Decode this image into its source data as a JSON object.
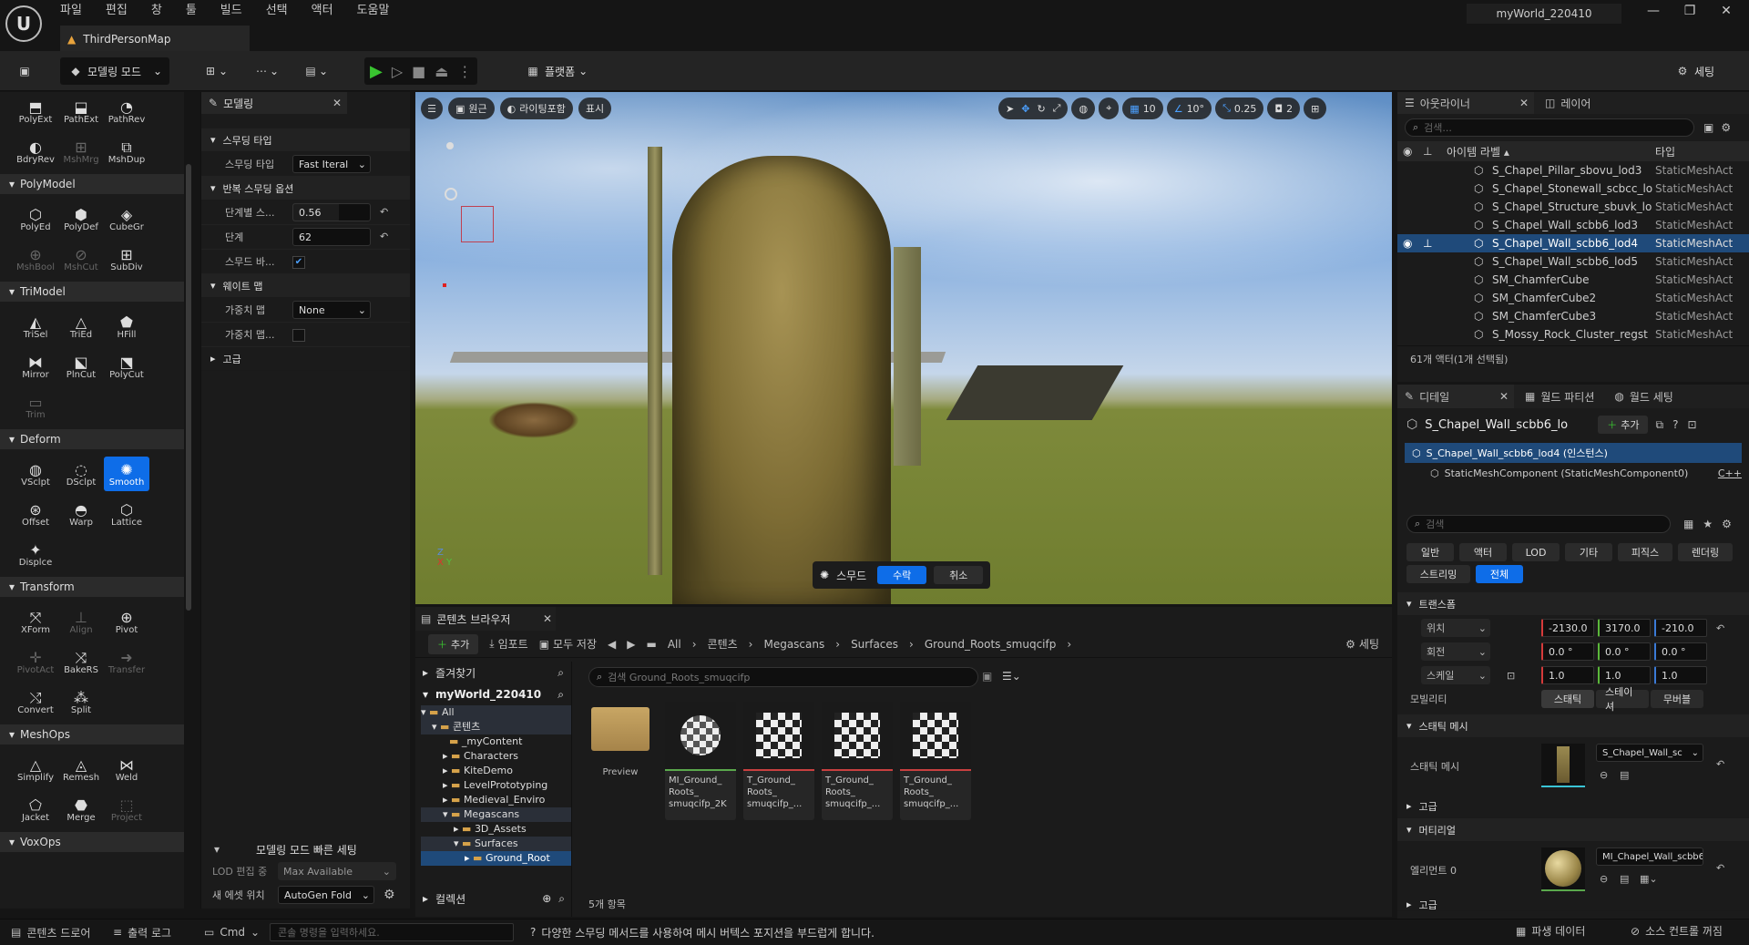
{
  "app": {
    "logo": "U",
    "project": "myWorld_220410",
    "map_tab": "ThirdPersonMap"
  },
  "menu": [
    "파일",
    "편집",
    "창",
    "툴",
    "빌드",
    "선택",
    "액터",
    "도움말"
  ],
  "toolbar": {
    "mode": "모델링 모드",
    "platform": "플랫폼",
    "settings": "세팅"
  },
  "left": {
    "top_row1": [
      "PolyExt",
      "PathExt",
      "PathRev"
    ],
    "top_row2": [
      "BdryRev",
      "MshMrg",
      "MshDup"
    ],
    "sections": [
      {
        "title": "PolyModel",
        "tools": [
          "PolyEd",
          "PolyDef",
          "CubeGr",
          "MshBool",
          "MshCut",
          "SubDiv"
        ]
      },
      {
        "title": "TriModel",
        "tools": [
          "TriSel",
          "TriEd",
          "HFill",
          "Mirror",
          "PlnCut",
          "PolyCut",
          "Trim"
        ]
      },
      {
        "title": "Deform",
        "tools": [
          "VSclpt",
          "DSclpt",
          "Smooth",
          "Offset",
          "Warp",
          "Lattice",
          "Displce"
        ]
      },
      {
        "title": "Transform",
        "tools": [
          "XForm",
          "Align",
          "Pivot",
          "PivotAct",
          "BakeRS",
          "Transfer",
          "Convert",
          "Split"
        ]
      },
      {
        "title": "MeshOps",
        "tools": [
          "Simplify",
          "Remesh",
          "Weld",
          "Jacket",
          "Merge",
          "Project"
        ]
      },
      {
        "title": "VoxOps",
        "tools": []
      }
    ]
  },
  "modeling": {
    "tab": "모델링",
    "smoothing_type_header": "스무딩 타입",
    "smoothing_type_label": "스무딩 타입",
    "smoothing_type_value": "Fast Iteral",
    "iter_header": "반복 스무딩 옵션",
    "step_label": "단계별 스...",
    "step_value": "0.56",
    "steps_label": "단계",
    "steps_value": "62",
    "smooth_boundary_label": "스무드 바...",
    "weight_header": "웨이트 맵",
    "weight_map_label": "가중치 맵",
    "weight_map_value": "None",
    "weight_map2_label": "가중치 맵...",
    "advanced": "고급",
    "quick_settings": "모델링 모드 빠른 세팅",
    "lod_label": "LOD 편집 중",
    "lod_value": "Max Available",
    "asset_label": "새 에셋 위치",
    "asset_value": "AutoGen Fold"
  },
  "viewport": {
    "perspective": "원근",
    "lighting": "라이팅포함",
    "show": "표시",
    "grid_value": "10",
    "angle_value": "10°",
    "scale_value": "0.25",
    "camera_value": "2",
    "smooth_label": "스무드",
    "accept": "수락",
    "cancel": "취소"
  },
  "content_browser": {
    "tab": "콘텐츠 브라우저",
    "add": "추가",
    "import": "임포트",
    "save_all": "모두 저장",
    "breadcrumb": [
      "All",
      "콘텐츠",
      "Megascans",
      "Surfaces",
      "Ground_Roots_smuqcifp"
    ],
    "settings": "세팅",
    "favorites": "즐겨찾기",
    "project": "myWorld_220410",
    "tree": [
      "All",
      "콘텐츠",
      "_myContent",
      "Characters",
      "KiteDemo",
      "LevelPrototyping",
      "Medieval_Enviro",
      "Megascans",
      "3D_Assets",
      "Surfaces",
      "Ground_Root"
    ],
    "collections": "컬렉션",
    "search_placeholder": "검색 Ground_Roots_smuqcifp",
    "assets": [
      {
        "name": "Preview"
      },
      {
        "name": "MI_Ground_ Roots_ smuqcifp_2K"
      },
      {
        "name": "T_Ground_ Roots_ smuqcifp_..."
      },
      {
        "name": "T_Ground_ Roots_ smuqcifp_..."
      },
      {
        "name": "T_Ground_ Roots_ smuqcifp_..."
      }
    ],
    "count": "5개 항목"
  },
  "outliner": {
    "tab": "아웃라이너",
    "layers": "레이어",
    "search_placeholder": "검색...",
    "col_label": "아이템 라벨 ▴",
    "col_type": "타입",
    "rows": [
      {
        "name": "S_Chapel_Pillar_sbovu_lod3",
        "type": "StaticMeshAct"
      },
      {
        "name": "S_Chapel_Stonewall_scbcc_lo",
        "type": "StaticMeshAct"
      },
      {
        "name": "S_Chapel_Structure_sbuvk_lo",
        "type": "StaticMeshAct"
      },
      {
        "name": "S_Chapel_Wall_scbb6_lod3",
        "type": "StaticMeshAct"
      },
      {
        "name": "S_Chapel_Wall_scbb6_lod4",
        "type": "StaticMeshAct"
      },
      {
        "name": "S_Chapel_Wall_scbb6_lod5",
        "type": "StaticMeshAct"
      },
      {
        "name": "SM_ChamferCube",
        "type": "StaticMeshAct"
      },
      {
        "name": "SM_ChamferCube2",
        "type": "StaticMeshAct"
      },
      {
        "name": "SM_ChamferCube3",
        "type": "StaticMeshAct"
      },
      {
        "name": "S_Mossy_Rock_Cluster_regst",
        "type": "StaticMeshAct"
      }
    ],
    "count": "61개 액터(1개 선택됨)"
  },
  "details": {
    "tab": "디테일",
    "world_partition": "월드 파티션",
    "world_settings": "월드 세팅",
    "actor_name": "S_Chapel_Wall_scbb6_lo",
    "add": "추가",
    "instance": "S_Chapel_Wall_scbb6_lod4 (인스턴스)",
    "component": "StaticMeshComponent (StaticMeshComponent0)",
    "component_tag": "C++",
    "search_placeholder": "검색",
    "filters": [
      "일반",
      "액터",
      "LOD",
      "기타",
      "피직스",
      "렌더링",
      "스트리밍",
      "전체"
    ],
    "transform": "트랜스폼",
    "location": "위치",
    "loc": [
      "-2130.0",
      "3170.0",
      "-210.0"
    ],
    "rotation": "회전",
    "rot": [
      "0.0 °",
      "0.0 °",
      "0.0 °"
    ],
    "scale": "스케일",
    "scl": [
      "1.0",
      "1.0",
      "1.0"
    ],
    "mobility": "모빌리티",
    "mobility_opts": [
      "스태틱",
      "스테이셔",
      "무버블"
    ],
    "static_mesh_header": "스태틱 메시",
    "static_mesh_label": "스태틱 메시",
    "static_mesh_value": "S_Chapel_Wall_sc",
    "advanced": "고급",
    "materials": "머티리얼",
    "element0": "엘리먼트 0",
    "element0_value": "MI_Chapel_Wall_scbb6",
    "more": "고급"
  },
  "statusbar": {
    "content_drawer": "콘텐츠 드로어",
    "output_log": "출력 로그",
    "cmd": "Cmd",
    "console_placeholder": "콘솔 명령을 입력하세요.",
    "message": "다양한 스무딩 메서드를 사용하여 메시 버텍스 포지션을 부드럽게 합니다.",
    "derived": "파생 데이터",
    "source_control": "소스 컨트롤 꺼짐"
  }
}
